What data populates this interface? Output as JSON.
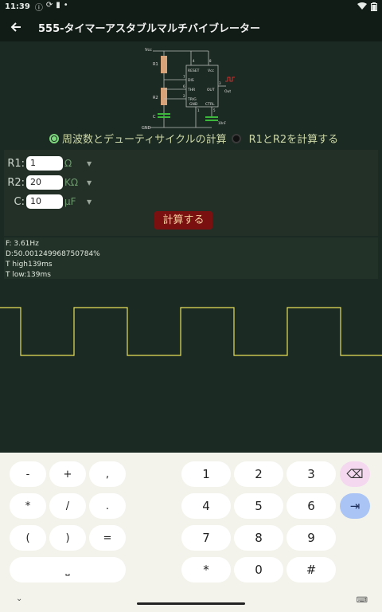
{
  "status_bar": {
    "time": "11:39"
  },
  "app_bar": {
    "title": "555-タイマーアスタブルマルチバイブレーター"
  },
  "circuit": {
    "vcc": "Vcc",
    "r1": "R1",
    "r2": "R2",
    "c": "C",
    "gnd": "GND",
    "reset": "RESET",
    "vcc_pin": "Vcc",
    "dis": "DIS",
    "thr": "THR",
    "trig": "TRIG",
    "gnd_pin": "GND",
    "ctrl": "CTRL",
    "out": "OUT",
    "out_label": "Out",
    "cap2": "10nF",
    "pin4": "4",
    "pin8": "8",
    "pin7": "7",
    "pin6": "6",
    "pin2": "2",
    "pin3": "3",
    "pin1": "1",
    "pin5": "5"
  },
  "mode": {
    "option1": "周波数とデューティサイクルの計算",
    "option2": "R1とR2を計算する",
    "selected": "option1"
  },
  "form": {
    "r1": {
      "label": "R1:",
      "value": "1",
      "unit": "Ω"
    },
    "r2": {
      "label": "R2:",
      "value": "20",
      "unit": "KΩ"
    },
    "c": {
      "label": "C:",
      "value": "10",
      "unit": "µF"
    },
    "calc_label": "計算する"
  },
  "results": {
    "f": "F: 3.61Hz",
    "d": "D:50.001249968750784%",
    "thigh": "T high139ms",
    "tlow": "T low:139ms"
  },
  "keyboard": {
    "left": [
      "-",
      "+",
      ",",
      "*",
      "/",
      ".",
      "(",
      ")",
      "="
    ],
    "space": "⎵",
    "digits": [
      "1",
      "2",
      "3",
      "4",
      "5",
      "6",
      "7",
      "8",
      "9"
    ],
    "bottom": [
      "*",
      "0",
      "#"
    ],
    "backspace": "⌫",
    "enter": "⇥"
  },
  "colors": {
    "accent": "#7ed87e",
    "button": "#7a1010",
    "wave": "#e8e05a",
    "background": "#1b2a22"
  }
}
